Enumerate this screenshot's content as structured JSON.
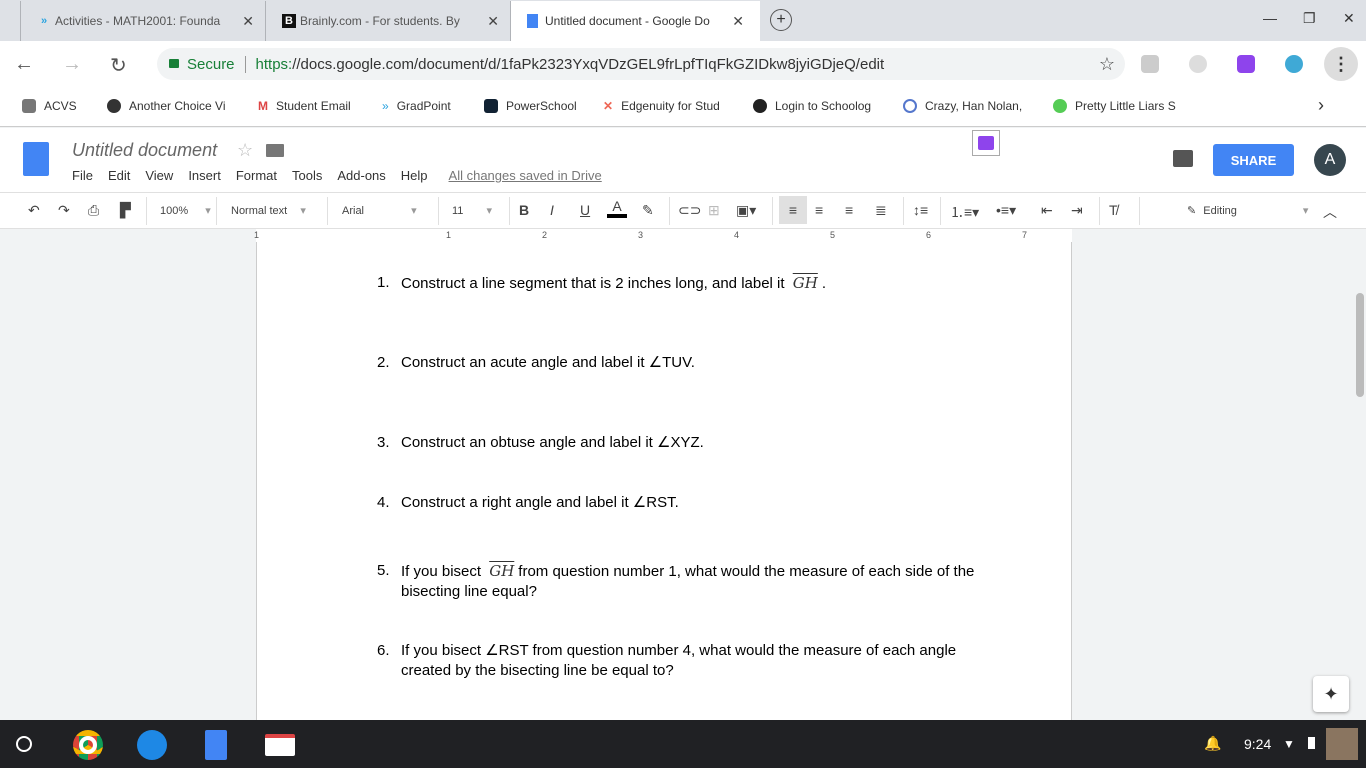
{
  "browser": {
    "tabs": [
      {
        "title": "Activities - MATH2001: Founda",
        "icon": "gradpoint-icon"
      },
      {
        "title": "Brainly.com - For students. By",
        "icon": "brainly-icon"
      },
      {
        "title": "Untitled document - Google Do",
        "icon": "docs-icon"
      }
    ],
    "secure_label": "Secure",
    "url_scheme": "https:",
    "url_rest": "//docs.google.com/document/d/1faPk2323YxqVDzGEL9frLpfTIqFkGZIDkw8jyiGDjeQ/edit",
    "bookmarks": [
      "ACVS",
      "Another Choice Vi",
      "Student Email",
      "GradPoint",
      "PowerSchool",
      "Edgenuity for Stud",
      "Login to Schoolog",
      "Crazy, Han Nolan,",
      "Pretty Little Liars S"
    ]
  },
  "docs": {
    "title": "Untitled document",
    "menu": [
      "File",
      "Edit",
      "View",
      "Insert",
      "Format",
      "Tools",
      "Add-ons",
      "Help"
    ],
    "saved": "All changes saved in Drive",
    "share": "SHARE",
    "avatar": "A",
    "toolbar": {
      "zoom": "100%",
      "style": "Normal text",
      "font": "Arial",
      "size": "11",
      "mode": "Editing",
      "text_color": "#000000"
    },
    "ruler": [
      "1",
      "1",
      "2",
      "3",
      "4",
      "5",
      "6",
      "7"
    ]
  },
  "questions": [
    {
      "num": "1.",
      "pre": "Construct a line segment that is 2 inches long, and label it",
      "seg": "GH",
      "post": "."
    },
    {
      "num": "2.",
      "text": "Construct an acute angle and label it ∠TUV."
    },
    {
      "num": "3.",
      "text": "Construct an obtuse angle and label it ∠XYZ."
    },
    {
      "num": "4.",
      "text": "Construct a right angle and label it ∠RST."
    },
    {
      "num": "5.",
      "pre": "If you bisect",
      "seg": "GH",
      "post": "from question number 1, what would the measure of each side of the bisecting line equal?"
    },
    {
      "num": "6.",
      "text": "If you bisect ∠RST from question number 4, what would the measure of each angle created by the bisecting line be equal to?"
    }
  ],
  "shelf": {
    "time": "9:24"
  }
}
